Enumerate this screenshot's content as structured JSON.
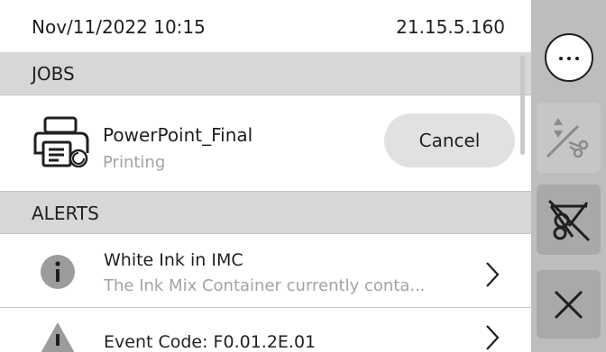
{
  "status_bar": {
    "datetime": "Nov/11/2022 10:15",
    "ip_address": "21.15.5.160"
  },
  "jobs": {
    "header": "JOBS",
    "items": [
      {
        "name": "PowerPoint_Final",
        "status": "Printing",
        "action_label": "Cancel",
        "icon": "printer-icon"
      }
    ]
  },
  "alerts": {
    "header": "ALERTS",
    "items": [
      {
        "icon": "info-icon",
        "title": "White Ink in IMC",
        "description": "The Ink Mix Container currently conta..."
      },
      {
        "icon": "warning-icon",
        "title": "Event Code: F0.01.2E.01",
        "description": ""
      }
    ]
  },
  "side_panel": {
    "buttons": [
      {
        "icon": "more-options-icon"
      },
      {
        "icon": "cut-adjust-icon",
        "state": "disabled"
      },
      {
        "icon": "no-cut-icon"
      },
      {
        "icon": "close-icon"
      }
    ]
  },
  "colors": {
    "background": "#ffffff",
    "section_header": "#d7d7d7",
    "side_panel": "#bdbdbd",
    "secondary_text": "#a3a3a3",
    "button": "#e1e1e1"
  }
}
